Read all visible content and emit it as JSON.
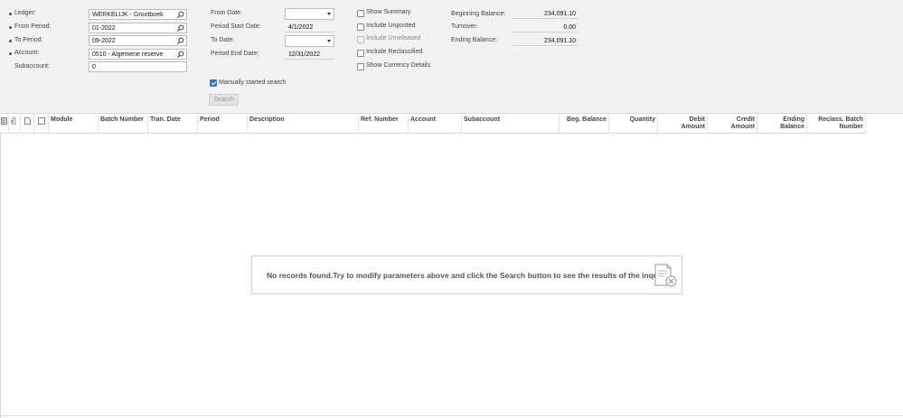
{
  "filters": {
    "ledger": {
      "label": "Ledger:",
      "value": "WERKELIJK - Grootboek"
    },
    "from_period": {
      "label": "From Period:",
      "value": "01-2022"
    },
    "to_period": {
      "label": "To Period:",
      "value": "09-2022"
    },
    "account": {
      "label": "Account:",
      "value": "0510 - Algemene reserve"
    },
    "subaccount": {
      "label": "Subaccount:",
      "value": "0"
    },
    "from_date": {
      "label": "From Date:",
      "value": ""
    },
    "period_start_date": {
      "label": "Period Start Date:",
      "value": "4/1/2022"
    },
    "to_date": {
      "label": "To Date:",
      "value": ""
    },
    "period_end_date": {
      "label": "Period End Date:",
      "value": "12/31/2022"
    }
  },
  "options": {
    "show_summary": {
      "label": "Show Summary",
      "checked": false,
      "enabled": true
    },
    "include_unposted": {
      "label": "Include Unposted",
      "checked": false,
      "enabled": true
    },
    "include_unreleased": {
      "label": "Include Unreleased",
      "checked": false,
      "enabled": false
    },
    "include_reclassified": {
      "label": "Include Reclassified",
      "checked": false,
      "enabled": true
    },
    "show_currency_details": {
      "label": "Show Currency Details",
      "checked": false,
      "enabled": true
    },
    "manually_started_search": {
      "label": "Manually started search",
      "checked": true,
      "enabled": true
    }
  },
  "summary": {
    "beginning_balance": {
      "label": "Beginning Balance:",
      "value": "234,091.10"
    },
    "turnover": {
      "label": "Turnover:",
      "value": "0.00"
    },
    "ending_balance": {
      "label": "Ending Balance:",
      "value": "234,091.10"
    }
  },
  "search_button": "Search",
  "grid": {
    "columns": {
      "module": "Module",
      "batch_number": "Batch Number",
      "tran_date": "Tran. Date",
      "period": "Period",
      "description": "Description",
      "ref_number": "Ref. Number",
      "account": "Account",
      "subaccount": "Subaccount",
      "beg_balance": "Beg. Balance",
      "quantity": "Quantity",
      "debit_amount": "Debit Amount",
      "credit_amount": "Credit Amount",
      "ending_balance": "Ending Balance",
      "reclass_batch_number": "Reclass. Batch Number"
    },
    "icon_columns": [
      "grid-settings-icon",
      "attachment-icon",
      "document-icon",
      "select-all-checkbox"
    ],
    "empty_message": "No records found.Try to modify parameters above and click the Search button to see the results of the inquiry.",
    "empty_icon": "no-records-document-icon"
  },
  "colors": {
    "accent": "#3b73b9",
    "panel_bg": "#f2f2f2",
    "border": "#d8d8d8"
  }
}
